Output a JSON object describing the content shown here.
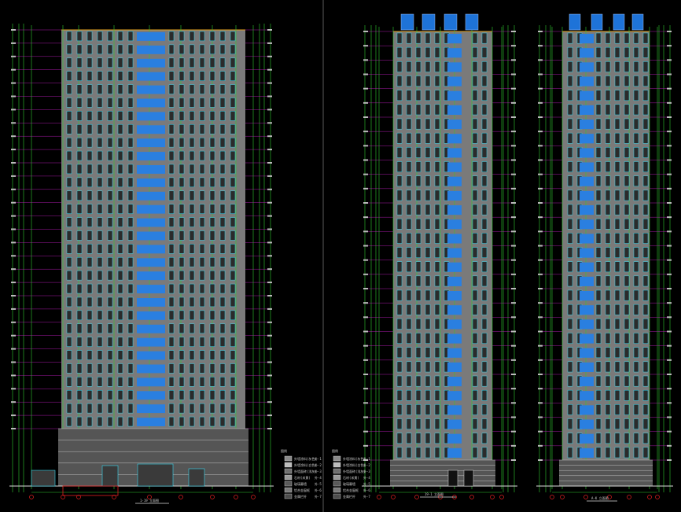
{
  "drawing_title": "",
  "colors": {
    "background": "#000000",
    "facade_fill": "#7a7a7a",
    "window_blue": "#1e73d8",
    "window_cyan": "#38d8f0",
    "balcony_blue": "#2a7fe0",
    "grid_green": "#2ecc2e",
    "grid_magenta": "#d020d0",
    "roof_orange": "#e0a020",
    "base_white": "#dcdcdc",
    "red_accent": "#e02020"
  },
  "elevations": [
    {
      "id": "north-elevation",
      "title_label": "1-19 立面图",
      "title_bound": "1-19 立面图"
    },
    {
      "id": "south-elevation",
      "title_label": "19-1 立面图",
      "title_bound": "19-1 立面图"
    },
    {
      "id": "side-elevation",
      "title_label": "A-K 立面图",
      "title_bound": "A-K 立面图"
    }
  ],
  "legend": {
    "heading": "图例",
    "items": [
      {
        "label": "外墙涂料(灰色)",
        "code": "外-1",
        "swatch": "#8a8a8a"
      },
      {
        "label": "外墙涂料(白色)",
        "code": "外-2",
        "swatch": "#bdbdbd"
      },
      {
        "label": "外墙面砖(浅灰)",
        "code": "外-3",
        "swatch": "#6e6e6e"
      },
      {
        "label": "石材(米黄)",
        "code": "外-4",
        "swatch": "#9a9a9a"
      },
      {
        "label": "玻璃幕墙",
        "code": "外-5",
        "swatch": "#5a5a5a"
      },
      {
        "label": "铝合金窗框",
        "code": "外-6",
        "swatch": "#7a7a7a"
      },
      {
        "label": "金属栏杆",
        "code": "外-7",
        "swatch": "#4d4d4d"
      }
    ]
  },
  "legend2": {
    "heading": "图例",
    "items": [
      {
        "label": "外墙涂料(灰色)",
        "code": "外-1",
        "swatch": "#8a8a8a"
      },
      {
        "label": "外墙涂料(白色)",
        "code": "外-2",
        "swatch": "#bdbdbd"
      },
      {
        "label": "外墙面砖(浅灰)",
        "code": "外-3",
        "swatch": "#6e6e6e"
      },
      {
        "label": "石材(米黄)",
        "code": "外-4",
        "swatch": "#9a9a9a"
      },
      {
        "label": "玻璃幕墙",
        "code": "外-5",
        "swatch": "#5a5a5a"
      },
      {
        "label": "铝合金窗框",
        "code": "外-6",
        "swatch": "#7a7a7a"
      },
      {
        "label": "金属栏杆",
        "code": "外-7",
        "swatch": "#4d4d4d"
      }
    ]
  },
  "floor_count": 30
}
